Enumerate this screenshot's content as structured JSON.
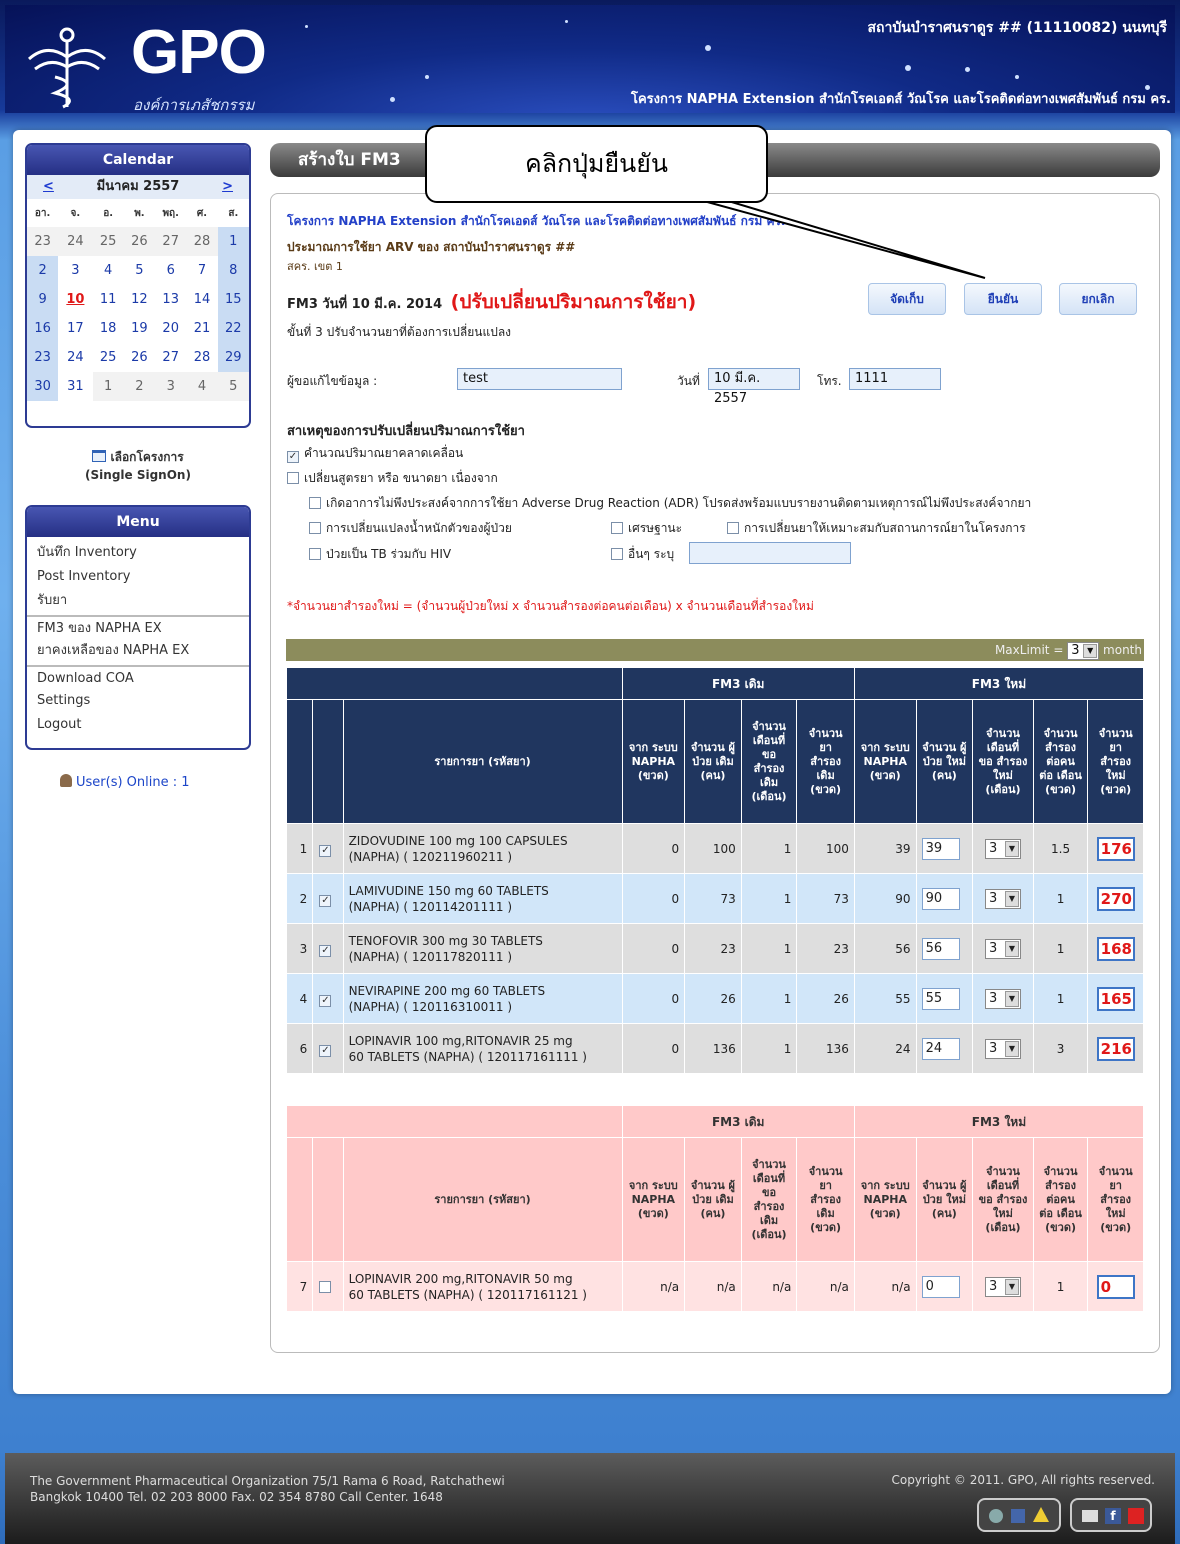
{
  "header": {
    "logo_text": "GPO",
    "logo_sub": "องค์การเภสัชกรรม",
    "org_name": "สถาบันบำราศนราดูร ## (11110082) นนทบุรี",
    "project": "โครงการ NAPHA Extension สำนักโรคเอดส์ วัณโรค และโรคติดต่อทางเพศสัมพันธ์ กรม คร."
  },
  "calendar": {
    "title": "Calendar",
    "prev": "<",
    "month": "มีนาคม 2557",
    "next": ">",
    "weekdays": [
      "อา.",
      "จ.",
      "อ.",
      "พ.",
      "พฤ.",
      "ศ.",
      "ส."
    ],
    "weeks": [
      [
        "23",
        "24",
        "25",
        "26",
        "27",
        "28",
        "1"
      ],
      [
        "2",
        "3",
        "4",
        "5",
        "6",
        "7",
        "8"
      ],
      [
        "9",
        "10",
        "11",
        "12",
        "13",
        "14",
        "15"
      ],
      [
        "16",
        "17",
        "18",
        "19",
        "20",
        "21",
        "22"
      ],
      [
        "23",
        "24",
        "25",
        "26",
        "27",
        "28",
        "29"
      ],
      [
        "30",
        "31",
        "1",
        "2",
        "3",
        "4",
        "5"
      ]
    ]
  },
  "sso": {
    "line1": "เลือกโครงการ",
    "line2": "(Single SignOn)"
  },
  "menu": {
    "title": "Menu",
    "items": [
      "บันทึก Inventory",
      "Post Inventory",
      "รับยา",
      "FM3 ของ NAPHA EX",
      "ยาคงเหลือของ NAPHA EX",
      "Download COA",
      "Settings",
      "Logout"
    ]
  },
  "online": "User(s) Online : 1",
  "page_title": "สร้างใบ FM3",
  "callout": "คลิกปุ่มยืนยัน",
  "content": {
    "project_link": "โครงการ NAPHA Extension สำนักโรคเอดส์ วัณโรค และโรคติดต่อทางเพศสัมพันธ์ กรม คร.",
    "estimate": "ประมาณการใช้ยา ARV ของ สถาบันบำราศนราดูร ##",
    "region": "สคร. เขต 1",
    "fm3_label": "FM3 วันที่ 10 มี.ค. 2014",
    "fm3_adjust": "(ปรับเปลี่ยนปริมาณการใช้ยา)",
    "step": "ขั้นที่ 3 ปรับจำนวนยาที่ต้องการเปลี่ยนแปลง",
    "buttons": {
      "save": "จัดเก็บ",
      "confirm": "ยืนยัน",
      "cancel": "ยกเลิก"
    },
    "editor_label": "ผู้ขอแก้ไขข้อมูล :",
    "editor_value": "test",
    "date_label": "วันที่",
    "date_value": "10 มี.ค. 2557",
    "tel_label": "โทร.",
    "tel_value": "1111",
    "reason_title": "สาเหตุของการปรับเปลี่ยนปริมาณการใช้ยา",
    "reasons": {
      "r1": "คำนวณปริมาณยาคลาดเคลื่อน",
      "r2": "เปลี่ยนสูตรยา หรือ ขนาดยา เนื่องจาก",
      "r3": "เกิดอาการไม่พึงประสงค์จากการใช้ยา Adverse Drug Reaction (ADR) โปรดส่งพร้อมแบบรายงานติดตามเหตุการณ์ไม่พึงประสงค์จากยา",
      "r4": "การเปลี่ยนแปลงน้ำหนักตัวของผู้ป่วย",
      "r5": "เศรษฐานะ",
      "r6": "การเปลี่ยนยาให้เหมาะสมกับสถานการณ์ยาในโครงการ",
      "r7": "ป่วยเป็น TB ร่วมกับ HIV",
      "r8": "อื่นๆ ระบุ"
    },
    "formula": "*จำนวนยาสำรองใหม่ = (จำนวนผู้ป่วยใหม่ x จำนวนสำรองต่อคนต่อเดือน) x จำนวนเดือนที่สำรองใหม่",
    "maxlimit_label": "MaxLimit =",
    "maxlimit_value": "3",
    "maxlimit_unit": "month",
    "group_old": "FM3 เดิม",
    "group_new": "FM3 ใหม่",
    "cols": {
      "drug": "รายการยา (รหัสยา)",
      "c1": "จาก ระบบ NAPHA (ขวด)",
      "c2": "จำนวน ผู้ป่วย เดิม (คน)",
      "c3": "จำนวน เดือนที่ ขอ สำรอง เดิม (เดือน)",
      "c4": "จำนวน ยา สำรอง เดิม (ขวด)",
      "c5": "จาก ระบบ NAPHA (ขวด)",
      "c6": "จำนวน ผู้ป่วย ใหม่ (คน)",
      "c7": "จำนวน เดือนที่ ขอ สำรอง ใหม่ (เดือน)",
      "c8": "จำนวน สำรอง ต่อคน ต่อ เดือน (ขวด)",
      "c9": "จำนวน ยา สำรอง ใหม่ (ขวด)"
    },
    "rows": [
      {
        "no": "1",
        "name": "ZIDOVUDINE 100 mg 100 CAPSULES",
        "code": "(NAPHA) ( 120211960211 )",
        "a": "0",
        "b": "100",
        "c": "1",
        "d": "100",
        "e": "39",
        "f": "39",
        "g": "3",
        "h": "1.5",
        "i": "176"
      },
      {
        "no": "2",
        "name": "LAMIVUDINE 150 mg 60 TABLETS",
        "code": "(NAPHA) ( 120114201111 )",
        "a": "0",
        "b": "73",
        "c": "1",
        "d": "73",
        "e": "90",
        "f": "90",
        "g": "3",
        "h": "1",
        "i": "270"
      },
      {
        "no": "3",
        "name": "TENOFOVIR 300 mg 30 TABLETS",
        "code": "(NAPHA) ( 120117820111 )",
        "a": "0",
        "b": "23",
        "c": "1",
        "d": "23",
        "e": "56",
        "f": "56",
        "g": "3",
        "h": "1",
        "i": "168"
      },
      {
        "no": "4",
        "name": "NEVIRAPINE 200 mg 60 TABLETS",
        "code": "(NAPHA) ( 120116310011 )",
        "a": "0",
        "b": "26",
        "c": "1",
        "d": "26",
        "e": "55",
        "f": "55",
        "g": "3",
        "h": "1",
        "i": "165"
      },
      {
        "no": "6",
        "name": "LOPINAVIR 100 mg,RITONAVIR 25 mg",
        "code": "60 TABLETS (NAPHA) ( 120117161111 )",
        "a": "0",
        "b": "136",
        "c": "1",
        "d": "136",
        "e": "24",
        "f": "24",
        "g": "3",
        "h": "3",
        "i": "216"
      }
    ],
    "row7": {
      "no": "7",
      "name": "LOPINAVIR 200 mg,RITONAVIR 50 mg",
      "code": "60 TABLETS (NAPHA) ( 120117161121 )",
      "a": "n/a",
      "b": "n/a",
      "c": "n/a",
      "d": "n/a",
      "e": "n/a",
      "f": "0",
      "g": "3",
      "h": "1",
      "i": "0"
    }
  },
  "footer": {
    "addr1": "The Government Pharmaceutical Organization 75/1 Rama 6 Road, Ratchathewi",
    "addr2": "Bangkok 10400 Tel. 02 203 8000 Fax. 02 354 8780 Call Center. 1648",
    "copyright": "Copyright © 2011. GPO, All rights reserved."
  }
}
